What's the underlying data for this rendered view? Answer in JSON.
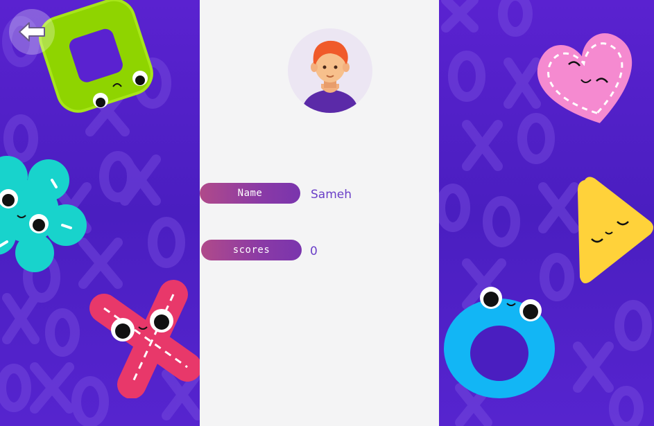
{
  "screen": "profile",
  "profile": {
    "name_label": "Name",
    "name_value": "Sameh",
    "scores_label": "scores",
    "scores_value": "0"
  },
  "icons": {
    "back": "back-arrow-icon",
    "avatar": "boy-avatar-icon"
  },
  "colors": {
    "background": "#4a1fb8",
    "panel": "#f4f4f5",
    "pill_start": "#b04a8a",
    "pill_end": "#7a35ad",
    "value_text": "#6a3fc8"
  },
  "decorations": [
    "green-square-toy",
    "teal-flower-toy",
    "red-x-toy",
    "pink-heart-toy",
    "yellow-triangle-toy",
    "blue-ring-toy"
  ]
}
